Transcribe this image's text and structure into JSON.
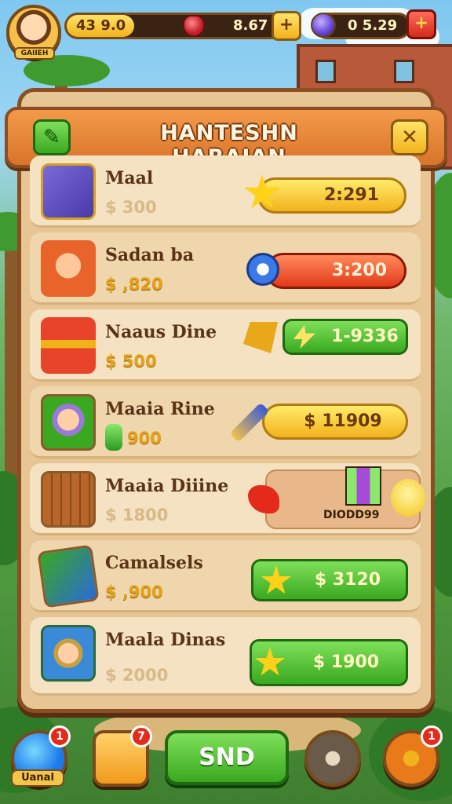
{
  "hud": {
    "player_name": "GAIIEH",
    "gold": "43 9.0",
    "gems": "8.67",
    "crystals": "0 5.29"
  },
  "panel": {
    "title": "HANTESHN HARAIAN"
  },
  "items": [
    {
      "name": "Maal",
      "price": "$ 300",
      "cost": "2:291",
      "cost_style": "yellow",
      "cost_icon": "star-icon",
      "price_faded": true
    },
    {
      "name": "Sadan ba",
      "price": "$ ,820",
      "cost": "3:200",
      "cost_style": "red",
      "cost_icon": "clock-icon",
      "price_faded": false
    },
    {
      "name": "Naaus Dine",
      "price": "$ 500",
      "cost": "1-9336",
      "cost_style": "green",
      "cost_icon": "gem-icon",
      "price_faded": false
    },
    {
      "name": "Maaia Rine",
      "price": "900",
      "cost": "$ 11909",
      "cost_style": "yellow",
      "cost_icon": "pencil-icon",
      "price_faded": false
    },
    {
      "name": "Maaia Diiine",
      "price": "$ 1800",
      "cost": "DIODD99",
      "cost_style": "badge",
      "cost_icon": "chick-icon",
      "price_faded": true
    },
    {
      "name": "Camalsels",
      "price": "$ ,900",
      "cost": "$ 3120",
      "cost_style": "green",
      "cost_icon": "star-icon",
      "price_faded": false
    },
    {
      "name": "Maala Dinas",
      "price": "$ 2000",
      "cost": "$ 1900",
      "cost_style": "green",
      "cost_icon": "star-icon",
      "price_faded": true
    }
  ],
  "bottom": {
    "left_label": "Uanal",
    "left_notif": "1",
    "second_notif": "7",
    "send_label": "SND",
    "settings_notif": "1"
  },
  "colors": {
    "panel_bg": "#e7c595",
    "header": "#e8843a",
    "green": "#3aa820",
    "gold": "#f2b21c",
    "red": "#e23a1a"
  }
}
